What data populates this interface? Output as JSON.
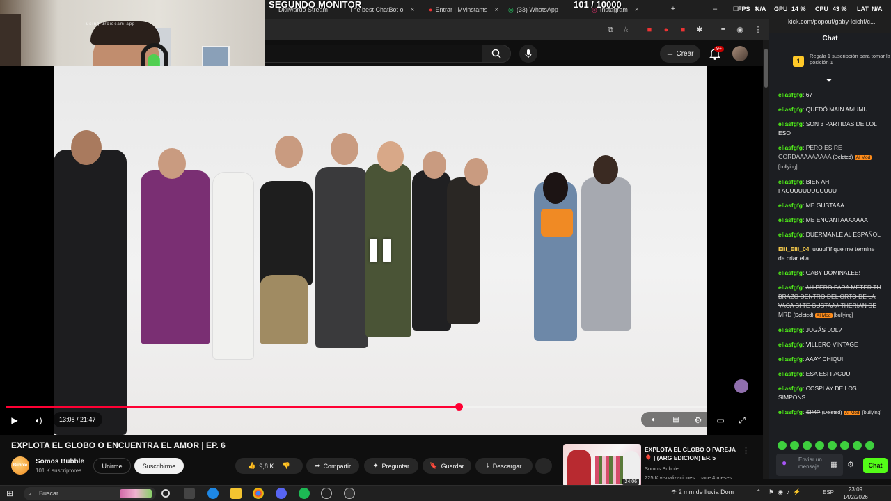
{
  "overlay": {
    "second_monitor": "SEGUNDO MONITOR",
    "counter": "101 / 10000",
    "cam_watermark": "using droidcam app"
  },
  "browser": {
    "tabs": [
      {
        "label": "Dkilwardo Stream"
      },
      {
        "label": "The best ChatBot o"
      },
      {
        "label": "Entrar | Mvinstants"
      },
      {
        "label": "(33) WhatsApp"
      },
      {
        "label": "Instagram"
      }
    ],
    "new_tab": "+",
    "window_controls": [
      "–",
      "□",
      "×"
    ]
  },
  "youtube": {
    "create_label": "Crear",
    "notif_badge": "9+",
    "time": "13:08 / 21:47",
    "progress_fraction": 0.645,
    "title": "EXPLOTA EL GLOBO O ENCUENTRA EL AMOR | EP. 6",
    "channel": "Somos Bubble",
    "channel_avatar_text": "Bubble",
    "subs": "101 K suscriptores",
    "join": "Unirme",
    "subscribe": "Suscribirme",
    "likes": "9,8 K",
    "share": "Compartir",
    "ask": "Preguntar",
    "save": "Guardar",
    "download": "Descargar",
    "recommended": {
      "title": "EXPLOTA EL GLOBO O PAREJA 🎈 | (ARG EDICION) EP. 5",
      "channel": "Somos Bubble",
      "meta": "225 K visualizaciones · hace 4 meses",
      "duration": "24:06"
    }
  },
  "system": {
    "perf": {
      "fps": "FPS",
      "fps_val": "N/A",
      "gpu": "GPU",
      "gpu_val": "14 %",
      "cpu": "CPU",
      "cpu_val": "43 %",
      "lat": "LAT",
      "lat_val": "N/A"
    }
  },
  "kick": {
    "url": "kick.com/popout/gaby-leicht/c...",
    "chat_heading": "Chat",
    "promo_rank": "1",
    "promo": "Regala 1 suscripción para tomar la posición 1",
    "messages": [
      {
        "user": "eliasfgfg",
        "text": "67"
      },
      {
        "user": "eliasfgfg",
        "text": "QUEDÓ MAIN AMUMU"
      },
      {
        "user": "eliasfgfg",
        "text": "SON 3 PARTIDAS DE LOL ESO"
      },
      {
        "user": "eliasfgfg",
        "text": "PERO ES RE GORDAAAAAAAAA",
        "deleted": "(Deleted)",
        "ai": "AI Mod",
        "label": "[bullying]"
      },
      {
        "user": "eliasfgfg",
        "text": "BIEN AHI FACUUUUUUUUUUU"
      },
      {
        "user": "eliasfgfg",
        "text": "ME GUSTAAA"
      },
      {
        "user": "eliasfgfg",
        "text": "ME ENCANTAAAAAAA"
      },
      {
        "user": "eliasfgfg",
        "text": "DUERMANLE AL ESPAÑOL"
      },
      {
        "user": "Elii_Elii_04",
        "text": "uuuuffff que me termine de criar ella"
      },
      {
        "user": "eliasfgfg",
        "text": "GABY DOMINALEE!"
      },
      {
        "user": "eliasfgfg",
        "text": "AH PERO PARA METER TU BRAZO DENTRO DEL ORTO DE LA VACA SI TE GUSTAAA THERIAN DE MRD",
        "deleted": "(Deleted)",
        "ai": "AI Mod",
        "label": "[bullying]"
      },
      {
        "user": "eliasfgfg",
        "text": "JUGÁS LOL?"
      },
      {
        "user": "eliasfgfg",
        "text": "VILLERO VINTAGE"
      },
      {
        "user": "eliasfgfg",
        "text": "AAAY CHIQUI"
      },
      {
        "user": "eliasfgfg",
        "text": "ESA ESI FACUU"
      },
      {
        "user": "eliasfgfg",
        "text": "COSPLAY DE LOS SIMPONS"
      },
      {
        "user": "eliasfgfg",
        "text": "SIMP",
        "deleted": "(Deleted)",
        "ai": "AI Mod",
        "label": "[bullying]"
      }
    ],
    "input_placeholder": "Enviar un mensaje",
    "send_label": "Chat"
  },
  "taskbar": {
    "search": "Buscar",
    "weather": "2 mm de lluvia Dom",
    "lang": "ESP",
    "time": "23:09",
    "date": "14/2/2026"
  }
}
